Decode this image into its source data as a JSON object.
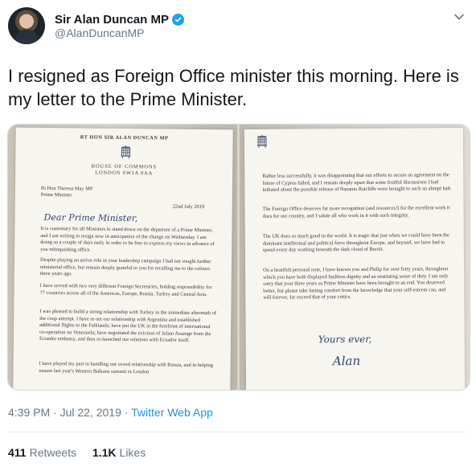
{
  "profile": {
    "display_name": "Sir Alan Duncan MP",
    "handle": "@AlanDuncanMP",
    "verified": true,
    "avatar_icon": "profile-photo-icon"
  },
  "tweet": {
    "text": "I resigned as Foreign Office minister this morning. Here is my letter to the Prime Minister.",
    "time": "4:39 PM",
    "date": "Jul 22, 2019",
    "separator": "·",
    "source": "Twitter Web App"
  },
  "stats": {
    "retweets_count": "411",
    "retweets_label": "Retweets",
    "likes_count": "1.1K",
    "likes_label": "Likes"
  },
  "letter_page_one": {
    "heading": "RT HON SIR ALAN DUNCAN MP",
    "house": "HOUSE OF COMMONS",
    "address": "LONDON SW1A 0AA",
    "recipient_name": "Rt Hon Theresa May MP",
    "recipient_title": "Prime Minister",
    "date": "22nd July 2019",
    "salutation": "Dear Prime Minister,",
    "paragraphs": [
      "It is customary for all Ministers to stand down on the departure of a Prime Minister, and I am writing to resign now in anticipation of the change on Wednesday. I am doing so a couple of days early in order to be free to express my views in advance of you relinquishing office.",
      "Despite playing an active role in your leadership campaign I had not sought further ministerial office, but remain deeply grateful to you for recalling me to the colours three years ago.",
      "I have served with two very different Foreign Secretaries, holding responsibility for 77 countries across all of the Americas, Europe, Russia, Turkey and Central Asia.",
      "I was pleased to build a strong relationship with Turkey in the immediate aftermath of the coup attempt. I have re-set our relationship with Argentina and established additional flights to the Falklands; have put the UK in the forefront of international co-operation on Venezuela; have negotiated the eviction of Julian Assange from the Ecuador embassy, and then re-launched our relations with Ecuador itself.",
      "I have played my part in handling our vexed relationship with Russia, and in helping ensure last year's Western Balkans summit in London"
    ]
  },
  "letter_page_two": {
    "paragraphs": [
      "Rather less successfully, it was disappointing that our efforts to secure an agreement on the future of Cyprus failed, and I remain deeply upset that some fruitful discussions I had initiated about the possible release of Nazanin Ratcliffe were brought to such an abrupt halt.",
      "The Foreign Office deserves far more recognition (and resources!) for the excellent work it does for our country, and I salute all who work in it with such integrity.",
      "The UK does so much good in the world. It is tragic that just when we could have been the dominant intellectual and political force throughout Europe, and beyond, we have had to spend every day working beneath the dark cloud of Brexit.",
      "On a heartfelt personal note, I have known you and Philip for over forty years, throughout which you have both displayed faultless dignity and an unstinting sense of duty. I am only sorry that your three years as Prime Minister have been brought to an end. You deserved better, but please take lasting comfort from the knowledge that your self-esteem can, and will forever, far exceed that of your critics."
    ],
    "signoff": "Yours ever,",
    "signature": "Alan"
  },
  "colors": {
    "link_blue": "#1b95e0",
    "verified_blue": "#1da1f2",
    "text_dark": "#14171a",
    "text_muted": "#657786"
  }
}
